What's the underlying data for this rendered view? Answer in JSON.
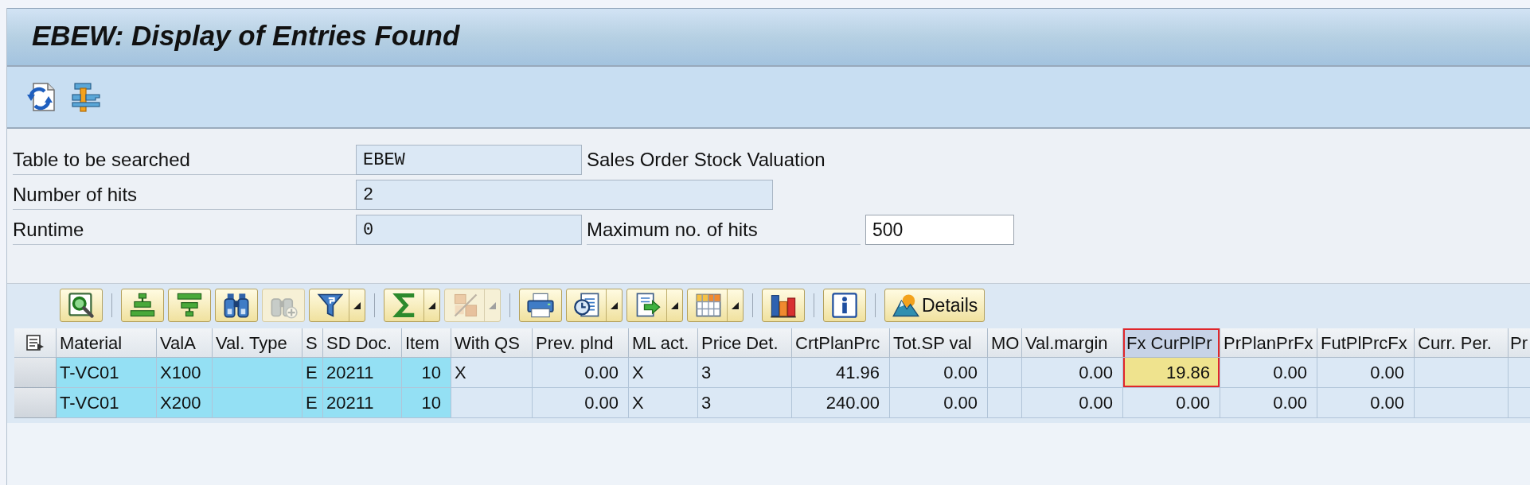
{
  "window": {
    "title": "EBEW: Display of Entries Found"
  },
  "form": {
    "rows": [
      {
        "label": "Table to be searched",
        "field": {
          "value": "EBEW",
          "editable": false
        },
        "description": "Sales Order Stock Valuation"
      },
      {
        "label": "Number of hits",
        "field": {
          "value": "2",
          "editable": false
        }
      },
      {
        "label": "Runtime",
        "field": {
          "value": "0",
          "editable": false
        },
        "second_label": "Maximum no. of hits",
        "second_field": {
          "value": "500",
          "editable": true
        }
      }
    ]
  },
  "table_toolbar": {
    "groups": [
      {
        "buttons": [
          {
            "disabled": false,
            "has_menu": false
          }
        ]
      },
      {
        "buttons": [
          {
            "disabled": false,
            "has_menu": false
          },
          {
            "disabled": false,
            "has_menu": false
          },
          {
            "disabled": false,
            "has_menu": false
          },
          {
            "disabled": true,
            "has_menu": false
          },
          {
            "disabled": false,
            "has_menu": true
          }
        ]
      },
      {
        "buttons": [
          {
            "disabled": false,
            "has_menu": true
          },
          {
            "disabled": true,
            "has_menu": true
          }
        ]
      },
      {
        "buttons": [
          {
            "disabled": false,
            "has_menu": false
          },
          {
            "disabled": false,
            "has_menu": true
          },
          {
            "disabled": false,
            "has_menu": true
          },
          {
            "disabled": false,
            "has_menu": true
          }
        ]
      },
      {
        "buttons": [
          {
            "disabled": false,
            "has_menu": false
          }
        ]
      },
      {
        "buttons": [
          {
            "disabled": false,
            "has_menu": false
          }
        ]
      },
      {
        "buttons": [
          {
            "label": "Details",
            "disabled": false,
            "has_menu": false
          }
        ]
      }
    ]
  },
  "table": {
    "columns": [
      {
        "label": "Material",
        "key": true,
        "kind": "text",
        "selected": false
      },
      {
        "label": "ValA",
        "key": true,
        "kind": "text",
        "selected": false
      },
      {
        "label": "Val. Type",
        "key": true,
        "selected": false
      },
      {
        "label": "S",
        "key": true,
        "kind": "text",
        "selected": false
      },
      {
        "label": "SD Doc.",
        "key": true,
        "kind": "text",
        "selected": false
      },
      {
        "label": "Item",
        "key": true,
        "kind": "number",
        "selected": false
      },
      {
        "label": "With QS",
        "key": false,
        "kind": "text",
        "selected": false
      },
      {
        "label": "Prev. plnd",
        "key": false,
        "kind": "number",
        "selected": false
      },
      {
        "label": "ML act.",
        "key": false,
        "kind": "text",
        "selected": false
      },
      {
        "label": "Price Det.",
        "key": false,
        "kind": "text",
        "selected": false
      },
      {
        "label": "CrtPlanPrc",
        "key": false,
        "kind": "number",
        "selected": false
      },
      {
        "label": "Tot.SP val",
        "key": false,
        "kind": "number",
        "selected": false
      },
      {
        "label": "MO",
        "key": false,
        "selected": false
      },
      {
        "label": "Val.margin",
        "key": false,
        "kind": "number",
        "selected": false
      },
      {
        "label": "Fx CurPlPr",
        "key": false,
        "kind": "number",
        "selected": true
      },
      {
        "label": "PrPlanPrFx",
        "key": false,
        "kind": "number",
        "selected": false
      },
      {
        "label": "FutPlPrcFx",
        "key": false,
        "kind": "number",
        "selected": false
      },
      {
        "label": "Curr. Per.",
        "key": false,
        "selected": false
      },
      {
        "label": "Pr",
        "key": false,
        "selected": false
      }
    ],
    "rows": [
      {
        "selected": false,
        "current": true,
        "cells": [
          "T-VC01",
          "X100",
          null,
          "E",
          "20211",
          "10",
          "X",
          "0.00",
          "X",
          "3",
          "41.96",
          "0.00",
          null,
          "0.00",
          "19.86",
          "0.00",
          "0.00",
          null,
          null
        ]
      },
      {
        "selected": false,
        "current": false,
        "cells": [
          "T-VC01",
          "X200",
          null,
          "E",
          "20211",
          "10",
          null,
          "0.00",
          "X",
          "3",
          "240.00",
          "0.00",
          null,
          "0.00",
          "0.00",
          "0.00",
          "0.00",
          null,
          null
        ]
      }
    ]
  }
}
